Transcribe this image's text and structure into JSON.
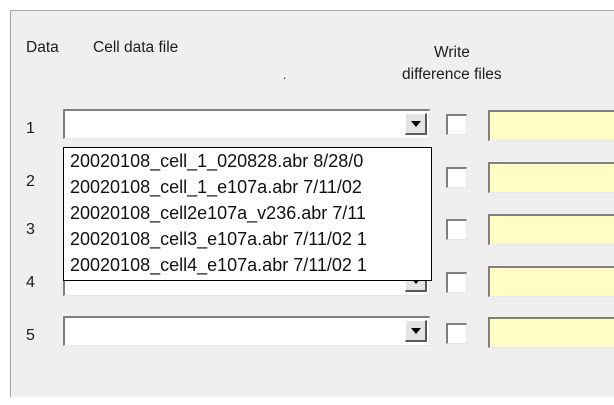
{
  "headers": {
    "data": "Data",
    "cell_data_file": "Cell data file",
    "write_line1": "Write",
    "write_line2": "difference files",
    "stray_mark": "."
  },
  "rows": [
    {
      "number": "1",
      "file": "",
      "write_checked": false,
      "output": ""
    },
    {
      "number": "2",
      "file": "",
      "write_checked": false,
      "output": ""
    },
    {
      "number": "3",
      "file": "",
      "write_checked": false,
      "output": ""
    },
    {
      "number": "4",
      "file": "",
      "write_checked": false,
      "output": ""
    },
    {
      "number": "5",
      "file": "",
      "write_checked": false,
      "output": ""
    }
  ],
  "dropdown": {
    "open_for_row": "1",
    "options": [
      "20020108_cell_1_020828.abr 8/28/0",
      "20020108_cell_1_e107a.abr 7/11/02",
      "20020108_cell2e107a_v236.abr 7/11",
      "20020108_cell3_e107a.abr 7/11/02 1",
      "20020108_cell4_e107a.abr 7/11/02 1"
    ]
  },
  "icons": {
    "dropdown_arrow": "chevron-down-icon"
  },
  "colors": {
    "panel": "#efefef",
    "output_field": "#fffcc4"
  }
}
